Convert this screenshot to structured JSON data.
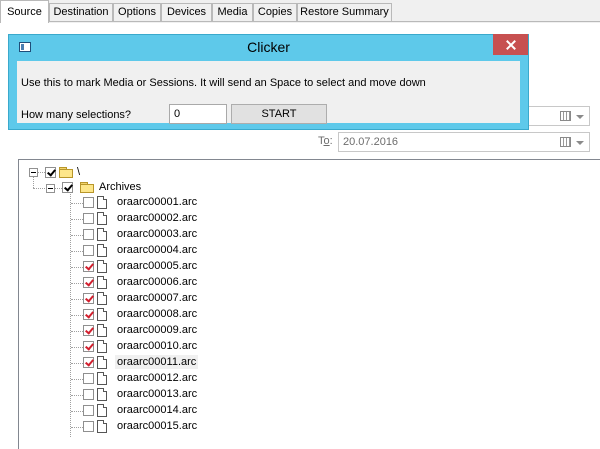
{
  "tabs": [
    {
      "label": "Source",
      "active": true
    },
    {
      "label": "Destination",
      "active": false
    },
    {
      "label": "Options",
      "active": false
    },
    {
      "label": "Devices",
      "active": false
    },
    {
      "label": "Media",
      "active": false
    },
    {
      "label": "Copies",
      "active": false
    },
    {
      "label": "Restore Summary",
      "active": false
    }
  ],
  "date_range": {
    "to_label_prefix": "T",
    "to_label_accel": "o",
    "to_label_suffix": ":",
    "to_value": "20.07.2016",
    "from_value": ""
  },
  "dialog": {
    "title": "Clicker",
    "message": "Use this to mark Media or Sessions. It will send an Space to select and move down",
    "prompt": "How many selections?",
    "count_value": "0",
    "start_label": "START"
  },
  "tree": {
    "root": {
      "label": "\\",
      "checked": true,
      "expanded": true
    },
    "archives": {
      "label": "Archives",
      "checked": true,
      "expanded": true
    },
    "files": [
      {
        "label": "oraarc00001.arc",
        "checked": false
      },
      {
        "label": "oraarc00002.arc",
        "checked": false
      },
      {
        "label": "oraarc00003.arc",
        "checked": false
      },
      {
        "label": "oraarc00004.arc",
        "checked": false
      },
      {
        "label": "oraarc00005.arc",
        "checked": true
      },
      {
        "label": "oraarc00006.arc",
        "checked": true
      },
      {
        "label": "oraarc00007.arc",
        "checked": true
      },
      {
        "label": "oraarc00008.arc",
        "checked": true
      },
      {
        "label": "oraarc00009.arc",
        "checked": true
      },
      {
        "label": "oraarc00010.arc",
        "checked": true
      },
      {
        "label": "oraarc00011.arc",
        "checked": true,
        "selected": true
      },
      {
        "label": "oraarc00012.arc",
        "checked": false
      },
      {
        "label": "oraarc00013.arc",
        "checked": false
      },
      {
        "label": "oraarc00014.arc",
        "checked": false
      },
      {
        "label": "oraarc00015.arc",
        "checked": false
      }
    ]
  },
  "colors": {
    "dialog_frame": "#5ec9ea",
    "close_button": "#c75050",
    "check_red": "#d21f2e",
    "check_black": "#000000"
  },
  "icons": {
    "tree_expander": "minus-box",
    "folder": "folder-icon",
    "file": "file-icon",
    "calendar": "calendar-icon"
  }
}
